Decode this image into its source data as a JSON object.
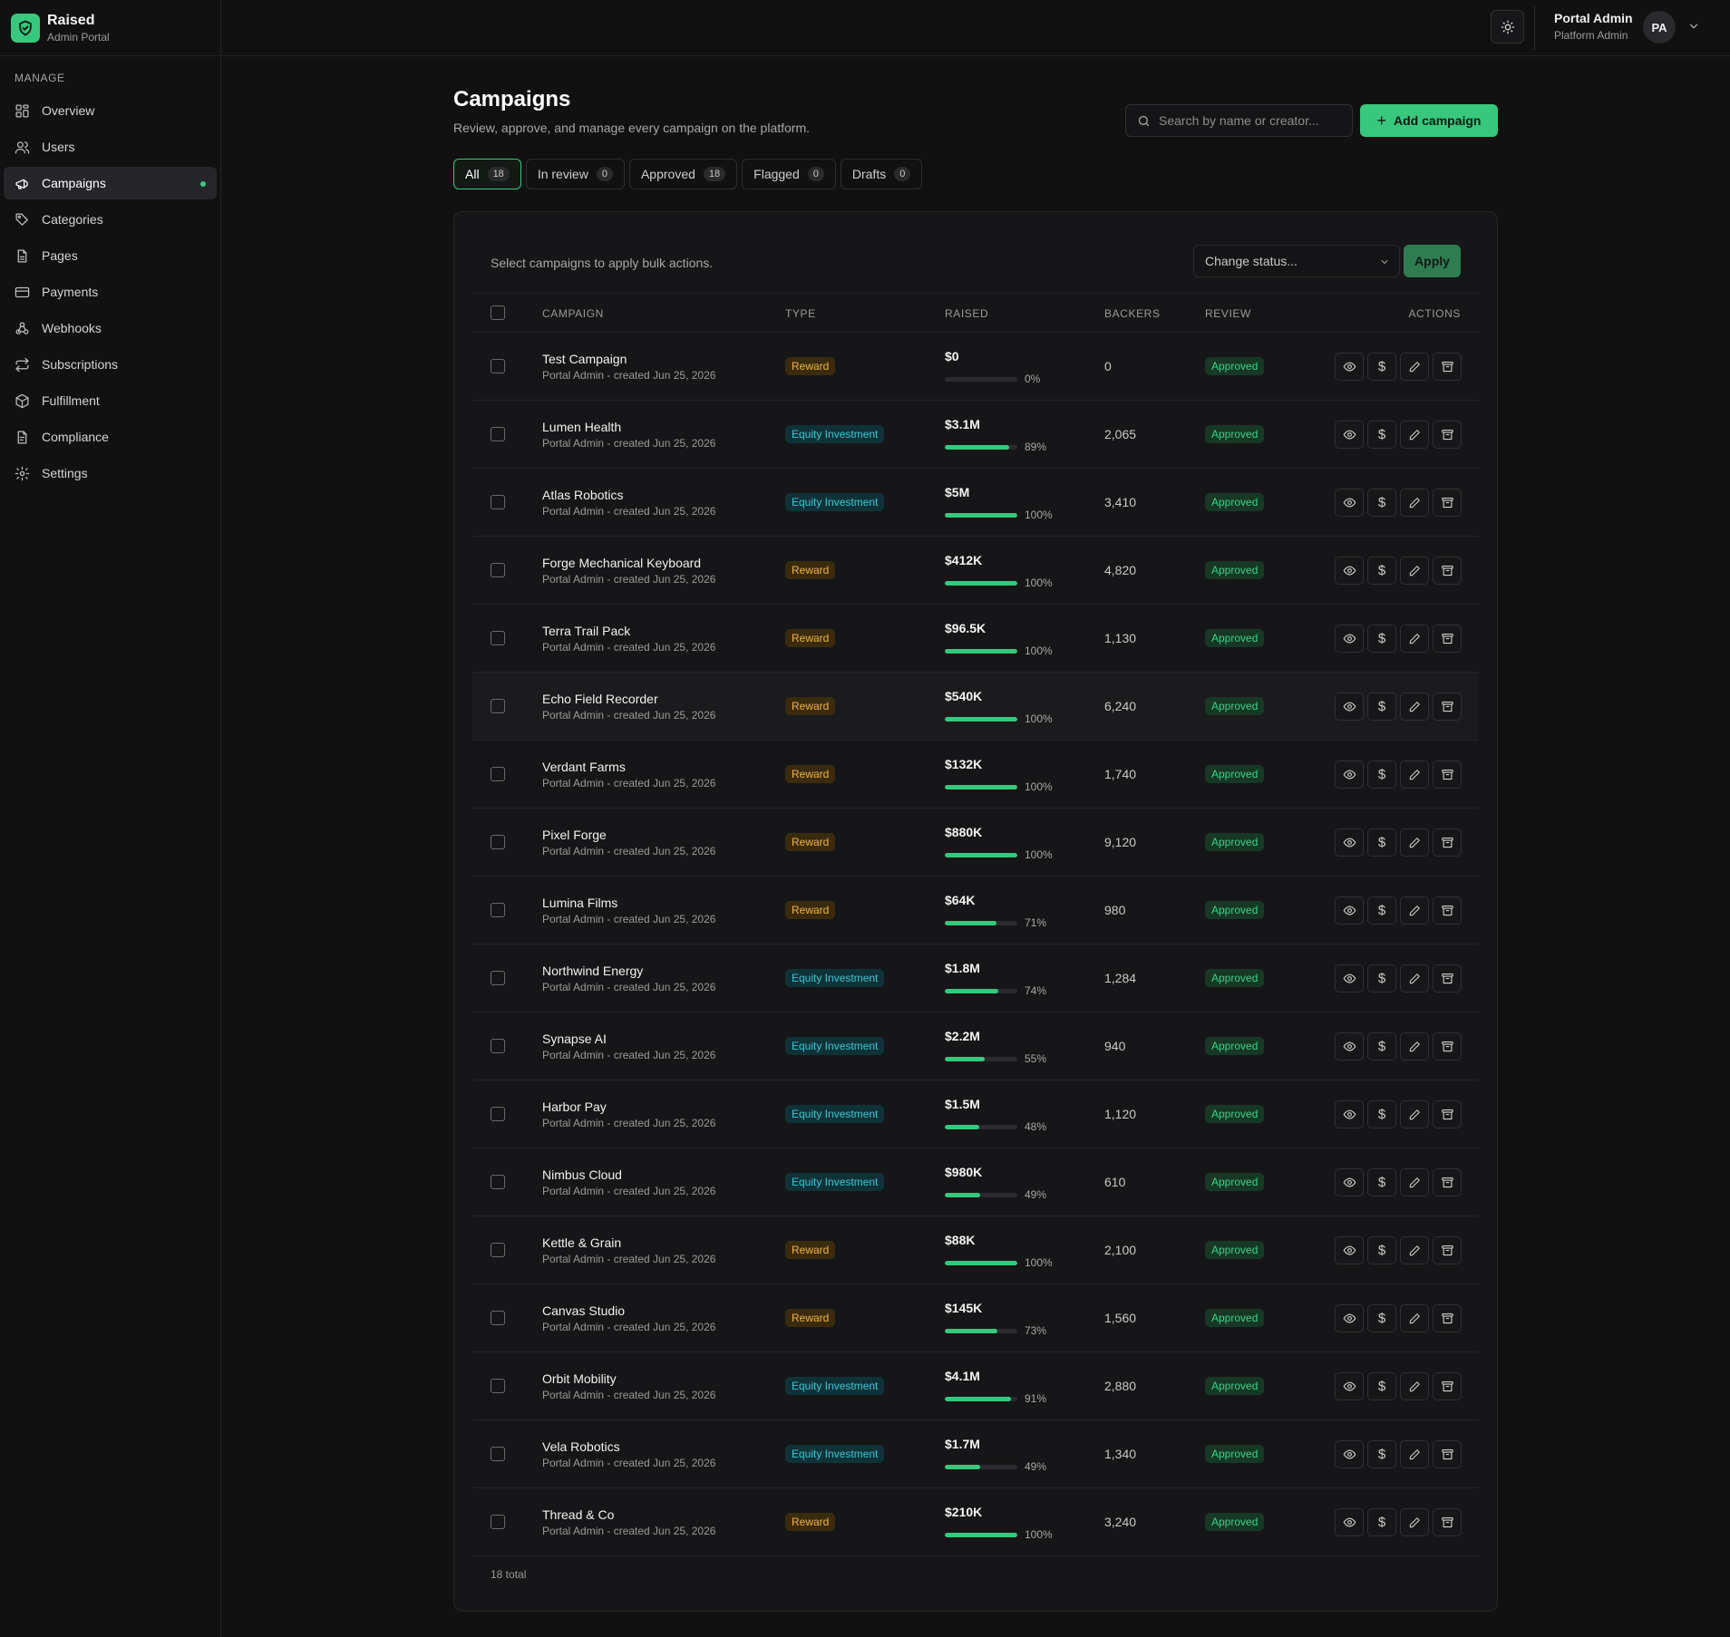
{
  "brand": {
    "name": "Raised",
    "subtitle": "Admin Portal"
  },
  "sidebar": {
    "heading": "MANAGE",
    "items": [
      {
        "label": "Overview",
        "icon": "grid-icon"
      },
      {
        "label": "Users",
        "icon": "users-icon"
      },
      {
        "label": "Campaigns",
        "icon": "megaphone-icon",
        "active": true
      },
      {
        "label": "Categories",
        "icon": "tag-icon"
      },
      {
        "label": "Pages",
        "icon": "file-icon"
      },
      {
        "label": "Payments",
        "icon": "credit-card-icon"
      },
      {
        "label": "Webhooks",
        "icon": "webhook-icon"
      },
      {
        "label": "Subscriptions",
        "icon": "repeat-icon"
      },
      {
        "label": "Fulfillment",
        "icon": "package-icon"
      },
      {
        "label": "Compliance",
        "icon": "document-icon"
      },
      {
        "label": "Settings",
        "icon": "gear-icon"
      }
    ]
  },
  "user": {
    "name": "Portal Admin",
    "role": "Platform Admin",
    "initials": "PA"
  },
  "page": {
    "title": "Campaigns",
    "description": "Review, approve, and manage every campaign on the platform.",
    "search_placeholder": "Search by name or creator...",
    "add_label": "Add campaign"
  },
  "tabs": [
    {
      "label": "All",
      "count": "18",
      "active": true
    },
    {
      "label": "In review",
      "count": "0"
    },
    {
      "label": "Approved",
      "count": "18"
    },
    {
      "label": "Flagged",
      "count": "0"
    },
    {
      "label": "Drafts",
      "count": "0"
    }
  ],
  "bulk": {
    "text": "Select campaigns to apply bulk actions.",
    "select_value": "Change status...",
    "apply_label": "Apply"
  },
  "table": {
    "headers": {
      "campaign": "CAMPAIGN",
      "type": "TYPE",
      "raised": "RAISED",
      "backers": "BACKERS",
      "review": "REVIEW",
      "actions": "ACTIONS"
    },
    "rows": [
      {
        "name": "Test Campaign",
        "meta": "Portal Admin - created Jun 25, 2026",
        "type": "Reward",
        "kind": "reward",
        "raised": "$0",
        "pct": "0%",
        "progress": 0,
        "backers": "0",
        "review": "Approved"
      },
      {
        "name": "Lumen Health",
        "meta": "Portal Admin - created Jun 25, 2026",
        "type": "Equity Investment",
        "kind": "equity",
        "raised": "$3.1M",
        "pct": "89%",
        "progress": 89,
        "backers": "2,065",
        "review": "Approved"
      },
      {
        "name": "Atlas Robotics",
        "meta": "Portal Admin - created Jun 25, 2026",
        "type": "Equity Investment",
        "kind": "equity",
        "raised": "$5M",
        "pct": "100%",
        "progress": 100,
        "backers": "3,410",
        "review": "Approved"
      },
      {
        "name": "Forge Mechanical Keyboard",
        "meta": "Portal Admin - created Jun 25, 2026",
        "type": "Reward",
        "kind": "reward",
        "raised": "$412K",
        "pct": "100%",
        "progress": 100,
        "backers": "4,820",
        "review": "Approved"
      },
      {
        "name": "Terra Trail Pack",
        "meta": "Portal Admin - created Jun 25, 2026",
        "type": "Reward",
        "kind": "reward",
        "raised": "$96.5K",
        "pct": "100%",
        "progress": 100,
        "backers": "1,130",
        "review": "Approved"
      },
      {
        "name": "Echo Field Recorder",
        "meta": "Portal Admin - created Jun 25, 2026",
        "type": "Reward",
        "kind": "reward",
        "raised": "$540K",
        "pct": "100%",
        "progress": 100,
        "backers": "6,240",
        "review": "Approved",
        "highlight": true
      },
      {
        "name": "Verdant Farms",
        "meta": "Portal Admin - created Jun 25, 2026",
        "type": "Reward",
        "kind": "reward",
        "raised": "$132K",
        "pct": "100%",
        "progress": 100,
        "backers": "1,740",
        "review": "Approved"
      },
      {
        "name": "Pixel Forge",
        "meta": "Portal Admin - created Jun 25, 2026",
        "type": "Reward",
        "kind": "reward",
        "raised": "$880K",
        "pct": "100%",
        "progress": 100,
        "backers": "9,120",
        "review": "Approved"
      },
      {
        "name": "Lumina Films",
        "meta": "Portal Admin - created Jun 25, 2026",
        "type": "Reward",
        "kind": "reward",
        "raised": "$64K",
        "pct": "71%",
        "progress": 71,
        "backers": "980",
        "review": "Approved"
      },
      {
        "name": "Northwind Energy",
        "meta": "Portal Admin - created Jun 25, 2026",
        "type": "Equity Investment",
        "kind": "equity",
        "raised": "$1.8M",
        "pct": "74%",
        "progress": 74,
        "backers": "1,284",
        "review": "Approved"
      },
      {
        "name": "Synapse AI",
        "meta": "Portal Admin - created Jun 25, 2026",
        "type": "Equity Investment",
        "kind": "equity",
        "raised": "$2.2M",
        "pct": "55%",
        "progress": 55,
        "backers": "940",
        "review": "Approved"
      },
      {
        "name": "Harbor Pay",
        "meta": "Portal Admin - created Jun 25, 2026",
        "type": "Equity Investment",
        "kind": "equity",
        "raised": "$1.5M",
        "pct": "48%",
        "progress": 48,
        "backers": "1,120",
        "review": "Approved"
      },
      {
        "name": "Nimbus Cloud",
        "meta": "Portal Admin - created Jun 25, 2026",
        "type": "Equity Investment",
        "kind": "equity",
        "raised": "$980K",
        "pct": "49%",
        "progress": 49,
        "backers": "610",
        "review": "Approved"
      },
      {
        "name": "Kettle & Grain",
        "meta": "Portal Admin - created Jun 25, 2026",
        "type": "Reward",
        "kind": "reward",
        "raised": "$88K",
        "pct": "100%",
        "progress": 100,
        "backers": "2,100",
        "review": "Approved"
      },
      {
        "name": "Canvas Studio",
        "meta": "Portal Admin - created Jun 25, 2026",
        "type": "Reward",
        "kind": "reward",
        "raised": "$145K",
        "pct": "73%",
        "progress": 73,
        "backers": "1,560",
        "review": "Approved"
      },
      {
        "name": "Orbit Mobility",
        "meta": "Portal Admin - created Jun 25, 2026",
        "type": "Equity Investment",
        "kind": "equity",
        "raised": "$4.1M",
        "pct": "91%",
        "progress": 91,
        "backers": "2,880",
        "review": "Approved"
      },
      {
        "name": "Vela Robotics",
        "meta": "Portal Admin - created Jun 25, 2026",
        "type": "Equity Investment",
        "kind": "equity",
        "raised": "$1.7M",
        "pct": "49%",
        "progress": 49,
        "backers": "1,340",
        "review": "Approved"
      },
      {
        "name": "Thread & Co",
        "meta": "Portal Admin - created Jun 25, 2026",
        "type": "Reward",
        "kind": "reward",
        "raised": "$210K",
        "pct": "100%",
        "progress": 100,
        "backers": "3,240",
        "review": "Approved"
      }
    ],
    "footer": "18 total"
  },
  "colors": {
    "accent": "#37c87d",
    "background": "#111112",
    "reward": "#f0b544",
    "equity": "#3cc6d6"
  }
}
